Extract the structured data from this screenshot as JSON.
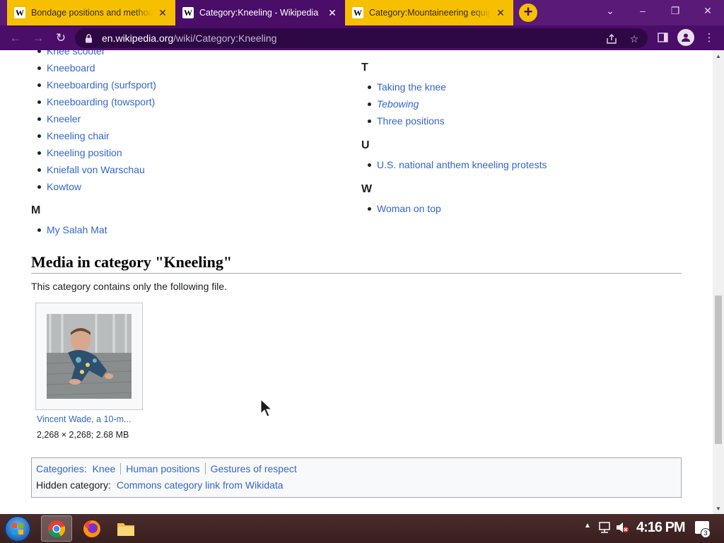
{
  "browser": {
    "tabs": [
      {
        "title": "Bondage positions and methods",
        "favicon": "W",
        "active": false
      },
      {
        "title": "Category:Kneeling - Wikipedia",
        "favicon": "W",
        "active": true
      },
      {
        "title": "Category:Mountaineering equipment",
        "favicon": "W",
        "active": false
      }
    ],
    "new_tab_label": "+",
    "url_host": "en.wikipedia.org",
    "url_path": "/wiki/Category:Kneeling",
    "window_controls": {
      "minimize": "–",
      "restore": "❐",
      "close": "✕"
    },
    "colors": {
      "tab_inactive": "#f6c000",
      "frame": "#4a0d68"
    }
  },
  "page": {
    "left_column": {
      "items_top": [
        "Knee scooter",
        "Kneeboard",
        "Kneeboarding (surfsport)",
        "Kneeboarding (towsport)",
        "Kneeler",
        "Kneeling chair",
        "Kneeling position",
        "Kniefall von Warschau",
        "Kowtow"
      ],
      "sections": [
        {
          "letter": "M",
          "items": [
            "My Salah Mat"
          ]
        }
      ]
    },
    "right_column": {
      "sections": [
        {
          "letter": "T",
          "items": [
            "Taking the knee",
            "Tebowing",
            "Three positions"
          ]
        },
        {
          "letter": "U",
          "items": [
            "U.S. national anthem kneeling protests"
          ]
        },
        {
          "letter": "W",
          "items": [
            "Woman on top"
          ]
        }
      ]
    },
    "media": {
      "heading": "Media in category \"Kneeling\"",
      "description": "This category contains only the following file.",
      "file_link": "Vincent Wade, a 10-m...",
      "file_meta": "2,268 × 2,268; 2.68 MB"
    },
    "catlinks": {
      "label": "Categories:",
      "categories": [
        "Knee",
        "Human positions",
        "Gestures of respect"
      ],
      "hidden_label": "Hidden category:",
      "hidden": "Commons category link from Wikidata"
    }
  },
  "taskbar": {
    "clock": "4:16 PM",
    "notification_count": "3",
    "apps": [
      "chrome",
      "firefox",
      "file-explorer"
    ]
  }
}
